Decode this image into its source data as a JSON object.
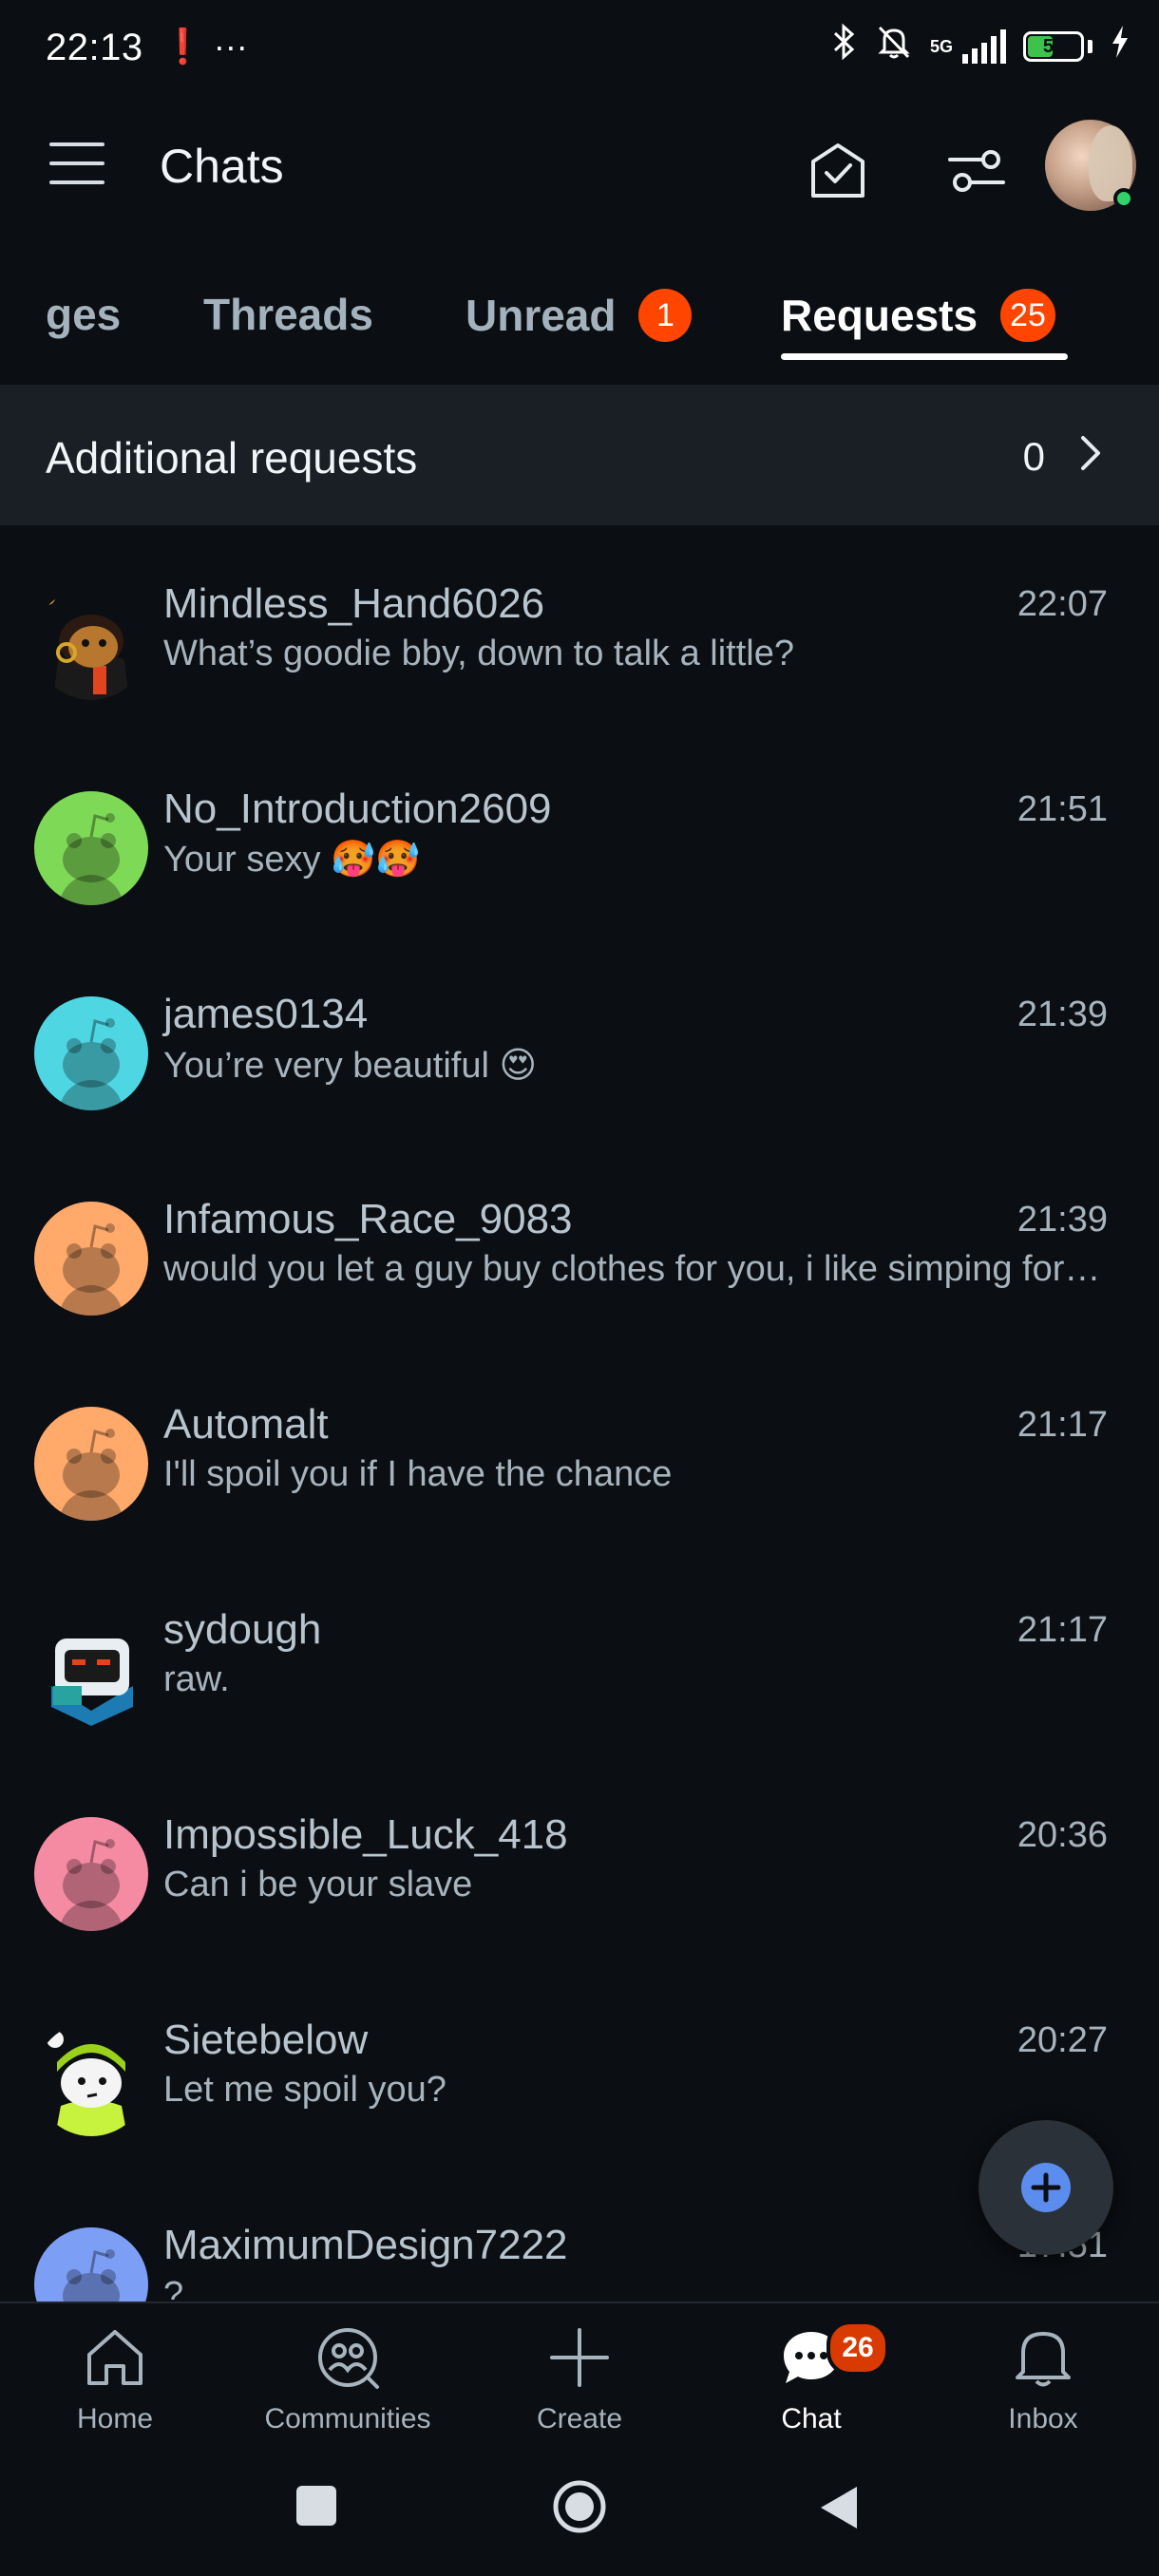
{
  "status_bar": {
    "time": "22:13",
    "left_icons": "❗ ···",
    "network": "5G",
    "battery": "52",
    "battery_level": 0.52
  },
  "app_bar": {
    "title": "Chats"
  },
  "tabs": [
    {
      "label": "ges",
      "badge": ""
    },
    {
      "label": "Threads",
      "badge": ""
    },
    {
      "label": "Unread",
      "badge": "1"
    },
    {
      "label": "Requests",
      "badge": "25",
      "active": true
    }
  ],
  "additional_requests": {
    "label": "Additional requests",
    "count": "0"
  },
  "chats": [
    {
      "name": "Mindless_Hand6026",
      "message": "What’s goodie bby, down to talk a little?",
      "time": "22:07",
      "avatar": "custom-snoo-dark",
      "color": "#6b3a1e"
    },
    {
      "name": "No_Introduction2609",
      "message": "Your sexy 🥵🥵",
      "time": "21:51",
      "avatar": "snoo",
      "color": "#7ed957"
    },
    {
      "name": "james0134",
      "message": "You’re very beautiful 😍",
      "time": "21:39",
      "avatar": "snoo",
      "color": "#4fd6e3"
    },
    {
      "name": "Infamous_Race_9083",
      "message": "would you let a guy buy clothes for you, i like simping for…",
      "time": "21:39",
      "avatar": "snoo",
      "color": "#ffa96b"
    },
    {
      "name": "Automalt",
      "message": "I'll spoil you if I have the chance",
      "time": "21:17",
      "avatar": "snoo",
      "color": "#ffa96b"
    },
    {
      "name": "sydough",
      "message": "raw.",
      "time": "21:17",
      "avatar": "custom-snoo-robot",
      "color": "#1c7bb3"
    },
    {
      "name": "Impossible_Luck_418",
      "message": "Can i be your slave",
      "time": "20:36",
      "avatar": "snoo",
      "color": "#f58ba3"
    },
    {
      "name": "Sietebelow",
      "message": "Let me spoil you?",
      "time": "20:27",
      "avatar": "custom-snoo-green",
      "color": "#c7f23d"
    },
    {
      "name": "MaximumDesign7222",
      "message": "?",
      "time": "17:51",
      "avatar": "snoo",
      "color": "#7d9ef5"
    }
  ],
  "bottom_nav": [
    {
      "label": "Home",
      "icon": "home-icon"
    },
    {
      "label": "Communities",
      "icon": "communities-icon"
    },
    {
      "label": "Create",
      "icon": "plus-icon"
    },
    {
      "label": "Chat",
      "icon": "chat-icon",
      "badge": "26",
      "active": true
    },
    {
      "label": "Inbox",
      "icon": "bell-icon"
    }
  ],
  "colors": {
    "background": "#0b0e12",
    "accent_badge": "#ff4500",
    "fab_plus": "#5b8def",
    "online": "#2fd36a"
  }
}
